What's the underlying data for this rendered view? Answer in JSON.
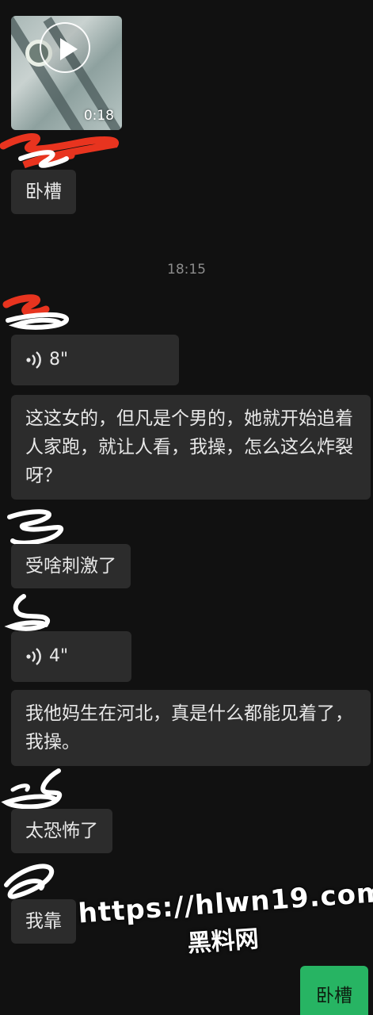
{
  "video": {
    "duration": "0:18"
  },
  "timestamp": "18:15",
  "messages": [
    {
      "kind": "text",
      "text": "卧槽"
    },
    {
      "kind": "voice",
      "duration": "8\""
    },
    {
      "kind": "text",
      "text": "这这女的，但凡是个男的，她就开始追着人家跑，就让人看，我操，怎么这么炸裂呀？"
    },
    {
      "kind": "text",
      "text": "受啥刺激了"
    },
    {
      "kind": "voice",
      "duration": "4\""
    },
    {
      "kind": "text",
      "text": "我他妈生在河北，真是什么都能见着了，我操。"
    },
    {
      "kind": "text",
      "text": "太恐怖了"
    },
    {
      "kind": "text",
      "text": "我靠"
    }
  ],
  "my_message": {
    "text": "卧槽"
  },
  "watermark": {
    "url": "https://hlwn19.com",
    "name": "黑料网"
  },
  "colors": {
    "background": "#111111",
    "bubble": "#2c2c2c",
    "my_bubble": "#27b463",
    "scribble_red": "#e8341f"
  }
}
